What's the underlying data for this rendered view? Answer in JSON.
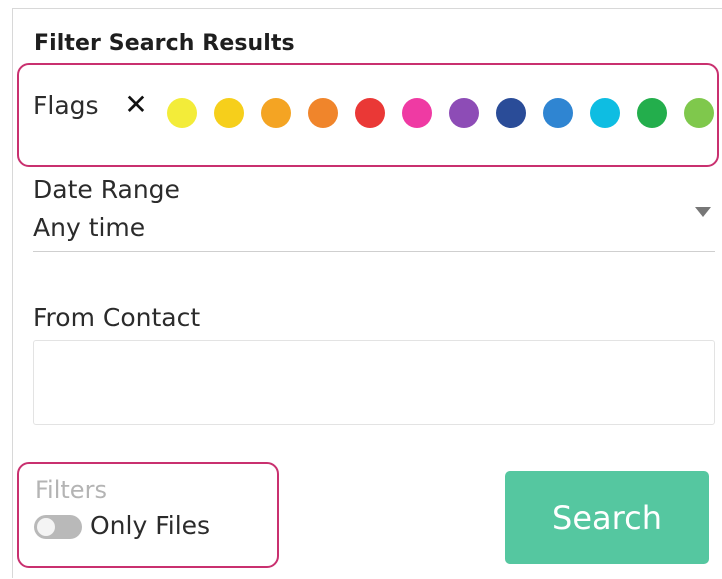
{
  "header": {
    "title": "Filter Search Results"
  },
  "flags": {
    "label": "Flags",
    "clear_icon": "close-icon",
    "clear_symbol": "✕",
    "colors": [
      {
        "name": "light-yellow",
        "hex": "#f3ec39"
      },
      {
        "name": "yellow",
        "hex": "#f6cf1b"
      },
      {
        "name": "orange",
        "hex": "#f4a423"
      },
      {
        "name": "dark-orange",
        "hex": "#f0852b"
      },
      {
        "name": "red",
        "hex": "#ea3836"
      },
      {
        "name": "pink",
        "hex": "#ef3aa3"
      },
      {
        "name": "purple",
        "hex": "#8d4cb6"
      },
      {
        "name": "navy",
        "hex": "#2a4c98"
      },
      {
        "name": "blue",
        "hex": "#2f85d2"
      },
      {
        "name": "cyan",
        "hex": "#0ebde2"
      },
      {
        "name": "green",
        "hex": "#23ae4c"
      },
      {
        "name": "light-green",
        "hex": "#7fc84c"
      }
    ]
  },
  "date_range": {
    "label": "Date Range",
    "value": "Any time",
    "arrow_icon": "triangle-down-icon"
  },
  "from_contact": {
    "label": "From Contact",
    "value": "",
    "placeholder": ""
  },
  "filters": {
    "label": "Filters",
    "only_files_label": "Only Files",
    "only_files_enabled": false
  },
  "actions": {
    "search_label": "Search"
  },
  "colors": {
    "highlight_border": "#c9306f",
    "search_button": "#55c7a0",
    "toggle_off": "#b9b9b9"
  }
}
